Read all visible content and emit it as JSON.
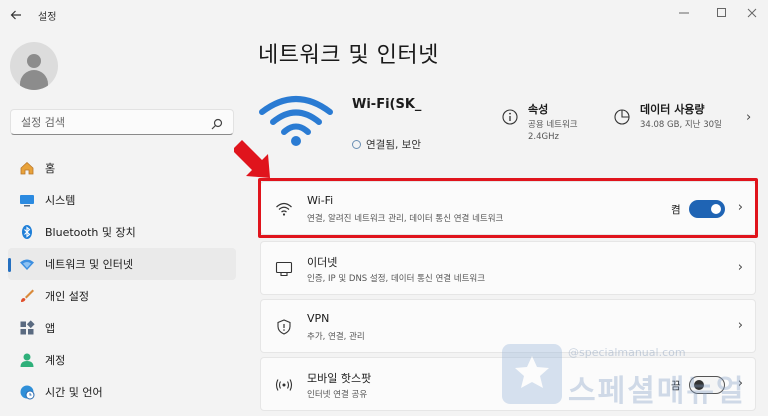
{
  "window": {
    "title": "설정",
    "back_icon": "back-arrow-icon",
    "controls": [
      "minimize",
      "maximize",
      "close"
    ]
  },
  "sidebar": {
    "search_placeholder": "설정 검색",
    "items": [
      {
        "label": "홈",
        "icon": "home-icon",
        "active": false
      },
      {
        "label": "시스템",
        "icon": "system-monitor-icon",
        "active": false
      },
      {
        "label": "Bluetooth 및 장치",
        "icon": "bluetooth-icon",
        "active": false
      },
      {
        "label": "네트워크 및 인터넷",
        "icon": "network-wifi-icon",
        "active": true
      },
      {
        "label": "개인 설정",
        "icon": "paintbrush-icon",
        "active": false
      },
      {
        "label": "앱",
        "icon": "apps-icon",
        "active": false
      },
      {
        "label": "계정",
        "icon": "account-icon",
        "active": false
      },
      {
        "label": "시간 및 언어",
        "icon": "globe-clock-icon",
        "active": false
      }
    ]
  },
  "main": {
    "title": "네트워크 및 인터넷",
    "hero": {
      "network_name": "Wi-Fi(SK_",
      "status": "연결됨, 보안",
      "properties": {
        "title": "속성",
        "line1": "공용 네트워크",
        "line2": "2.4GHz"
      },
      "data_usage": {
        "title": "데이터 사용량",
        "subtitle": "34.08 GB, 지난 30일"
      }
    },
    "cards": [
      {
        "title": "Wi-Fi",
        "subtitle": "연결, 알려진 네트워크 관리, 데이터 통신 연결 네트워크",
        "icon": "wifi-icon",
        "toggle_label": "켬",
        "toggle_on": true
      },
      {
        "title": "이더넷",
        "subtitle": "인증, IP 및 DNS 설정, 데이터 통신 연결 네트워크",
        "icon": "ethernet-icon"
      },
      {
        "title": "VPN",
        "subtitle": "추가, 연결, 관리",
        "icon": "shield-icon"
      },
      {
        "title": "모바일 핫스팟",
        "subtitle": "인터넷 연결 공유",
        "icon": "hotspot-icon",
        "toggle_label": "끔",
        "toggle_on": false
      }
    ]
  },
  "watermark": {
    "url": "@specialmanual.com",
    "text": "스페셜매뉴얼"
  },
  "colors": {
    "accent": "#1f64b4",
    "highlight": "#e0141c",
    "wifi_hero": "#2a7bd3"
  }
}
